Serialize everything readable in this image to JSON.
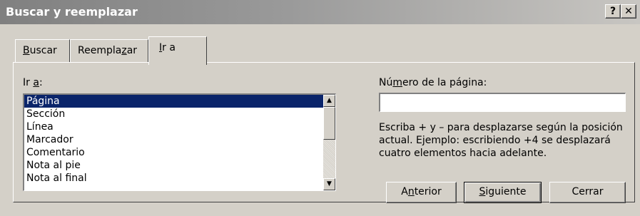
{
  "window": {
    "title": "Buscar y reemplazar",
    "help_button": "?",
    "close_button": "✕"
  },
  "tabs": [
    {
      "label": "Buscar",
      "mnemonic_index": 0,
      "active": false
    },
    {
      "label": "Reemplazar",
      "mnemonic_index": 8,
      "active": false
    },
    {
      "label": "Ir a",
      "mnemonic_index": 0,
      "active": true
    }
  ],
  "goto": {
    "label": "Ir a:",
    "items": [
      "Página",
      "Sección",
      "Línea",
      "Marcador",
      "Comentario",
      "Nota al pie",
      "Nota al final"
    ],
    "selected_index": 0
  },
  "page_number": {
    "label": "Número de la página:",
    "value": "",
    "help_text": "Escriba + y – para desplazarse según la posición actual. Ejemplo: escribiendo +4 se desplazará cuatro elementos hacia adelante."
  },
  "buttons": {
    "previous": "Anterior",
    "next": "Siguiente",
    "close": "Cerrar"
  },
  "colors": {
    "dialog_bg": "#d4d0c8",
    "selection": "#0a246a"
  }
}
